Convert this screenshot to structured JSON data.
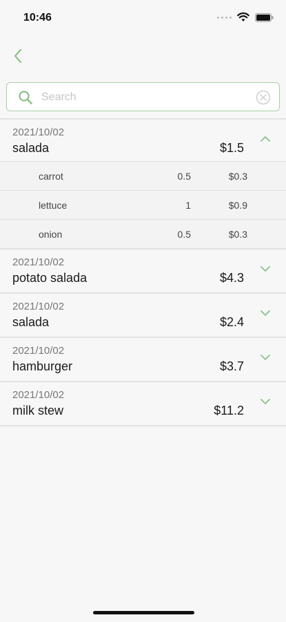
{
  "status_bar": {
    "time": "10:46"
  },
  "search": {
    "placeholder": "Search",
    "value": ""
  },
  "colors": {
    "accent": "#8cc08a",
    "border": "#a9cfa6"
  },
  "icons": {
    "back": "chevron-left-icon",
    "search": "search-icon",
    "clear": "clear-circle-icon"
  },
  "orders": [
    {
      "date": "2021/10/02",
      "name": "salada",
      "price": "$1.5",
      "expanded": true,
      "items": [
        {
          "name": "carrot",
          "qty": "0.5",
          "price": "$0.3"
        },
        {
          "name": "lettuce",
          "qty": "1",
          "price": "$0.9"
        },
        {
          "name": "onion",
          "qty": "0.5",
          "price": "$0.3"
        }
      ]
    },
    {
      "date": "2021/10/02",
      "name": "potato salada",
      "price": "$4.3",
      "expanded": false
    },
    {
      "date": "2021/10/02",
      "name": "salada",
      "price": "$2.4",
      "expanded": false
    },
    {
      "date": "2021/10/02",
      "name": "hamburger",
      "price": "$3.7",
      "expanded": false
    },
    {
      "date": "2021/10/02",
      "name": "milk stew",
      "price": "$11.2",
      "expanded": false
    }
  ]
}
